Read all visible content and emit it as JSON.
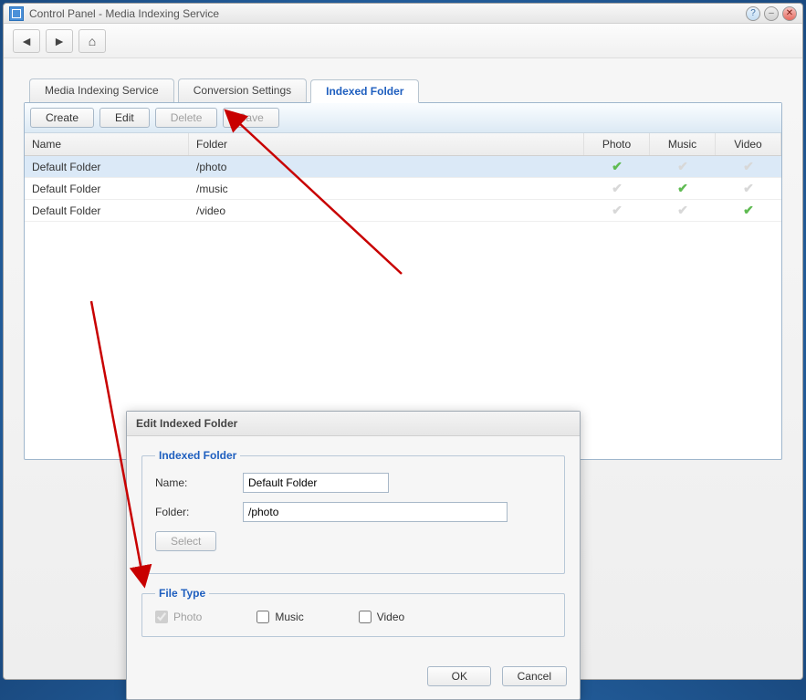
{
  "window": {
    "title": "Control Panel - Media Indexing Service"
  },
  "tabs": {
    "media": "Media Indexing Service",
    "conversion": "Conversion Settings",
    "indexed": "Indexed Folder"
  },
  "toolbar": {
    "create": "Create",
    "edit": "Edit",
    "delete": "Delete",
    "save": "Save"
  },
  "table": {
    "headers": {
      "name": "Name",
      "folder": "Folder",
      "photo": "Photo",
      "music": "Music",
      "video": "Video"
    },
    "rows": [
      {
        "name": "Default Folder",
        "folder": "/photo",
        "photo": true,
        "music": false,
        "video": false
      },
      {
        "name": "Default Folder",
        "folder": "/music",
        "photo": false,
        "music": true,
        "video": false
      },
      {
        "name": "Default Folder",
        "folder": "/video",
        "photo": false,
        "music": false,
        "video": true
      }
    ]
  },
  "dialog": {
    "title": "Edit Indexed Folder",
    "fieldset1_legend": "Indexed Folder",
    "name_label": "Name:",
    "name_value": "Default Folder",
    "folder_label": "Folder:",
    "folder_value": "/photo",
    "select_btn": "Select",
    "fieldset2_legend": "File Type",
    "photo_label": "Photo",
    "music_label": "Music",
    "video_label": "Video",
    "ok": "OK",
    "cancel": "Cancel"
  }
}
